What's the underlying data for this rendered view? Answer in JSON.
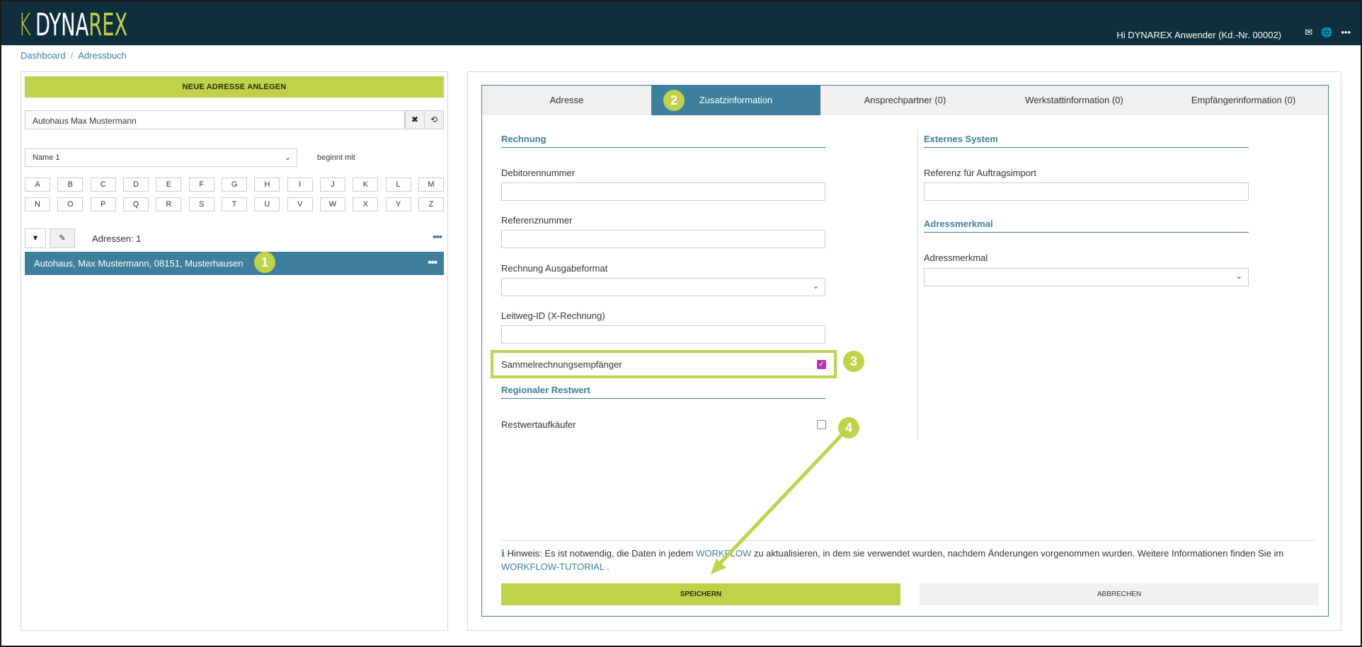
{
  "header": {
    "logo_k": "K",
    "logo_dyna": "DYNA",
    "logo_rex": "REX",
    "greeting": "Hi DYNAREX Anwender (Kd.-Nr. 00002)",
    "icons": [
      "mail-icon",
      "globe-icon",
      "more-icon"
    ]
  },
  "breadcrumb": {
    "items": [
      "Dashboard",
      "Adressbuch"
    ],
    "sep": "/"
  },
  "left": {
    "new_button": "NEUE ADRESSE ANLEGEN",
    "search_value": "Autohaus Max Mustermann",
    "clear_glyph": "✖",
    "reset_glyph": "⟲",
    "name_select": "Name 1",
    "match_mode": "beginnt mit",
    "letters_row1": [
      "A",
      "B",
      "C",
      "D",
      "E",
      "F",
      "G",
      "H",
      "I",
      "J",
      "K",
      "L",
      "M"
    ],
    "letters_row2": [
      "N",
      "O",
      "P",
      "Q",
      "R",
      "S",
      "T",
      "U",
      "V",
      "W",
      "X",
      "Y",
      "Z"
    ],
    "count_label": "Adressen: 1",
    "more_glyph": "•••",
    "rows": [
      {
        "label": "Autohaus, Max Mustermann, 08151, Musterhausen"
      }
    ]
  },
  "markers": [
    "1",
    "2",
    "3",
    "4"
  ],
  "tabs": [
    "Adresse",
    "Zusatzinformation",
    "Ansprechpartner (0)",
    "Werkstattinformation (0)",
    "Empfängerinformation (0)"
  ],
  "active_tab": 1,
  "form_left": {
    "section_rechnung": "Rechnung",
    "debitorennummer": "Debitorennummer",
    "referenznummer": "Referenznummer",
    "ausgabeformat": "Rechnung Ausgabeformat",
    "leitweg": "Leitweg-ID (X-Rechnung)",
    "sammel": "Sammelrechnungsempfänger",
    "sammel_checked": true,
    "section_restwert": "Regionaler Restwert",
    "restwert": "Restwertaufkäufer",
    "restwert_checked": false
  },
  "form_right": {
    "section_extern": "Externes System",
    "referenz": "Referenz für Auftragsimport",
    "section_merkmal": "Adressmerkmal",
    "merkmal": "Adressmerkmal"
  },
  "hint": {
    "icon": "info-icon",
    "prefix": "Hinweis: Es ist notwendig, die Daten in jedem ",
    "link1": "WORKFLOW",
    "middle": " zu aktualisieren, in dem sie verwendet wurden, nachdem Änderungen vorgenommen wurden. Weitere Informationen finden Sie im ",
    "link2": "WORKFLOW-TUTORIAL",
    "suffix": " ."
  },
  "buttons": {
    "save": "SPEICHERN",
    "cancel": "ABBRECHEN"
  },
  "colors": {
    "topbar": "#0e2f3b",
    "accent": "#c0d14a",
    "primary": "#3d7f9c",
    "checkbox": "#b833b8"
  }
}
